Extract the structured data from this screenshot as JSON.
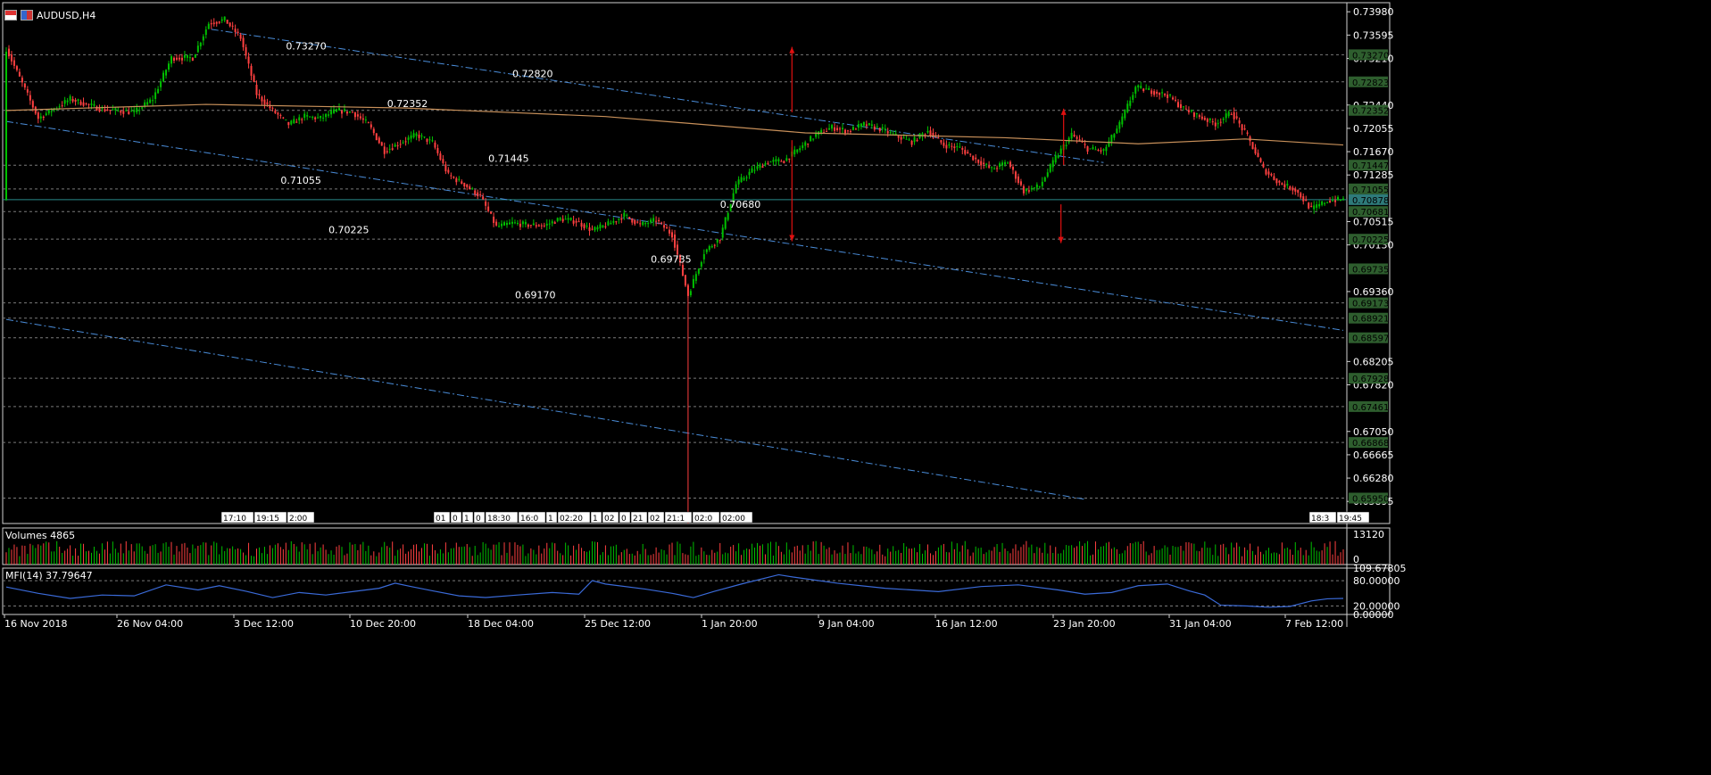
{
  "window": {
    "symbol_label": "AUDUSD,H4"
  },
  "price_axis": {
    "ticks": [
      "0.73980",
      "0.73595",
      "0.73210",
      "0.72440",
      "0.72055",
      "0.71670",
      "0.71285",
      "0.70515",
      "0.70130",
      "0.69360",
      "0.68205",
      "0.67820",
      "0.67050",
      "0.66665",
      "0.66280",
      "0.65895"
    ],
    "badges": [
      {
        "label": "0.73270",
        "value": 0.7327,
        "color": "#2e5e2e"
      },
      {
        "label": "0.72823",
        "value": 0.72823,
        "color": "#2e5e2e"
      },
      {
        "label": "0.72352",
        "value": 0.72352,
        "color": "#2e5e2e"
      },
      {
        "label": "0.71447",
        "value": 0.71447,
        "color": "#2e5e2e"
      },
      {
        "label": "0.71055",
        "value": 0.71055,
        "color": "#2e5e2e"
      },
      {
        "label": "0.70878",
        "value": 0.70878,
        "color": "#2e7a7a"
      },
      {
        "label": "0.70681",
        "value": 0.70681,
        "color": "#2e5e2e"
      },
      {
        "label": "0.70225",
        "value": 0.70225,
        "color": "#2e5e2e"
      },
      {
        "label": "0.69735",
        "value": 0.69735,
        "color": "#2e5e2e"
      },
      {
        "label": "0.69173",
        "value": 0.69173,
        "color": "#2e5e2e"
      },
      {
        "label": "0.68921",
        "value": 0.68921,
        "color": "#2e5e2e"
      },
      {
        "label": "0.68597",
        "value": 0.68597,
        "color": "#2e5e2e"
      },
      {
        "label": "0.67928",
        "value": 0.67928,
        "color": "#2e5e2e"
      },
      {
        "label": "0.67461",
        "value": 0.67461,
        "color": "#2e5e2e"
      },
      {
        "label": "0.66868",
        "value": 0.66868,
        "color": "#2e5e2e"
      },
      {
        "label": "0.65950",
        "value": 0.6595,
        "color": "#2e5e2e"
      }
    ]
  },
  "time_axis": {
    "labels": [
      "16 Nov 2018",
      "26 Nov 04:00",
      "3 Dec 12:00",
      "10 Dec 20:00",
      "18 Dec 04:00",
      "25 Dec 12:00",
      "1 Jan 20:00",
      "9 Jan 04:00",
      "16 Jan 12:00",
      "23 Jan 20:00",
      "31 Jan 04:00",
      "7 Feb 12:00"
    ]
  },
  "level_labels": [
    "0.73270",
    "0.72820",
    "0.72352",
    "0.71445",
    "0.71055",
    "0.70680",
    "0.70225",
    "0.69735",
    "0.69170"
  ],
  "event_markers": {
    "left": [
      "17:10",
      "19:15",
      "2:00"
    ],
    "middle": [
      "01",
      "0",
      "1",
      "0",
      "18:30",
      "16:0",
      "1",
      "02:20",
      "1",
      "02",
      "0",
      "21",
      "02",
      "21:1",
      "02:0",
      "02:00"
    ],
    "right": [
      "18:3",
      "19:45"
    ]
  },
  "volumes": {
    "title": "Volumes 4865",
    "ticks": [
      "13120",
      "0"
    ]
  },
  "mfi": {
    "title": "MFI(14) 37.79647",
    "ticks": [
      "109.67805",
      "80.00000",
      "20.00000",
      "0.00000"
    ]
  },
  "colors": {
    "bull": "#00c000",
    "bear": "#ff4040",
    "trendline": "#4a8cd8",
    "ma": "#c8905a",
    "mfi": "#3a6ad8",
    "arrow": "#e01010",
    "bid": "#2a8a8a"
  },
  "chart_data": {
    "type": "candlestick",
    "symbol": "AUDUSD",
    "timeframe": "H4",
    "ylim": [
      0.6553,
      0.7413
    ],
    "close_last": 0.70878,
    "close_path": [
      [
        0,
        0.7337
      ],
      [
        12,
        0.7222
      ],
      [
        24,
        0.7254
      ],
      [
        36,
        0.7237
      ],
      [
        48,
        0.7232
      ],
      [
        55,
        0.7254
      ],
      [
        62,
        0.7322
      ],
      [
        70,
        0.7322
      ],
      [
        76,
        0.7379
      ],
      [
        82,
        0.7385
      ],
      [
        88,
        0.7355
      ],
      [
        94,
        0.7262
      ],
      [
        100,
        0.7235
      ],
      [
        106,
        0.7212
      ],
      [
        112,
        0.7225
      ],
      [
        118,
        0.7222
      ],
      [
        124,
        0.7235
      ],
      [
        130,
        0.7232
      ],
      [
        136,
        0.7212
      ],
      [
        142,
        0.7168
      ],
      [
        148,
        0.7182
      ],
      [
        154,
        0.7195
      ],
      [
        160,
        0.7182
      ],
      [
        166,
        0.7128
      ],
      [
        172,
        0.7113
      ],
      [
        178,
        0.7093
      ],
      [
        184,
        0.7043
      ],
      [
        190,
        0.7049
      ],
      [
        196,
        0.7046
      ],
      [
        202,
        0.7045
      ],
      [
        208,
        0.7056
      ],
      [
        214,
        0.7052
      ],
      [
        220,
        0.7037
      ],
      [
        226,
        0.7047
      ],
      [
        232,
        0.7062
      ],
      [
        238,
        0.7046
      ],
      [
        244,
        0.7054
      ],
      [
        250,
        0.703
      ],
      [
        256,
        0.693
      ],
      [
        262,
        0.7001
      ],
      [
        268,
        0.7025
      ],
      [
        274,
        0.7113
      ],
      [
        280,
        0.7136
      ],
      [
        286,
        0.715
      ],
      [
        292,
        0.7152
      ],
      [
        298,
        0.7173
      ],
      [
        304,
        0.7195
      ],
      [
        310,
        0.7207
      ],
      [
        316,
        0.7201
      ],
      [
        322,
        0.7212
      ],
      [
        328,
        0.7205
      ],
      [
        334,
        0.7193
      ],
      [
        340,
        0.7183
      ],
      [
        346,
        0.7202
      ],
      [
        352,
        0.7178
      ],
      [
        358,
        0.7173
      ],
      [
        364,
        0.7154
      ],
      [
        370,
        0.7138
      ],
      [
        376,
        0.715
      ],
      [
        382,
        0.7102
      ],
      [
        388,
        0.711
      ],
      [
        394,
        0.7157
      ],
      [
        400,
        0.7195
      ],
      [
        406,
        0.7172
      ],
      [
        412,
        0.7168
      ],
      [
        418,
        0.7212
      ],
      [
        424,
        0.7273
      ],
      [
        430,
        0.7267
      ],
      [
        436,
        0.726
      ],
      [
        442,
        0.7238
      ],
      [
        448,
        0.7225
      ],
      [
        454,
        0.7213
      ],
      [
        460,
        0.7232
      ],
      [
        466,
        0.7192
      ],
      [
        472,
        0.7138
      ],
      [
        478,
        0.7115
      ],
      [
        484,
        0.7104
      ],
      [
        490,
        0.7072
      ],
      [
        496,
        0.7086
      ],
      [
        502,
        0.7088
      ]
    ],
    "moving_average": [
      [
        0,
        0.7235
      ],
      [
        75,
        0.7245
      ],
      [
        150,
        0.7239
      ],
      [
        225,
        0.7225
      ],
      [
        300,
        0.7198
      ],
      [
        375,
        0.719
      ],
      [
        425,
        0.718
      ],
      [
        465,
        0.7188
      ],
      [
        502,
        0.7178
      ]
    ],
    "trendlines": [
      {
        "from": [
          77,
          0.7369
        ],
        "to": [
          412,
          0.7149
        ],
        "style": "dash-dot"
      },
      {
        "from": [
          0,
          0.7217
        ],
        "to": [
          502,
          0.6872
        ],
        "style": "dash-dot"
      },
      {
        "from": [
          0,
          0.689
        ],
        "to": [
          405,
          0.6593
        ],
        "style": "dash-dot"
      }
    ],
    "level_lines": [
      0.7327,
      0.72823,
      0.72352,
      0.71447,
      0.71055,
      0.70878,
      0.70681,
      0.70225,
      0.69735,
      0.69173,
      0.68921,
      0.68597,
      0.67928,
      0.67461,
      0.66868,
      0.6595
    ],
    "volume_max": 13120,
    "mfi_range": [
      0.0,
      109.67805
    ],
    "mfi_levels": [
      80,
      20
    ],
    "mfi_last": 37.79647,
    "mfi_path": [
      [
        0,
        65
      ],
      [
        12,
        50
      ],
      [
        24,
        38
      ],
      [
        36,
        46
      ],
      [
        48,
        44
      ],
      [
        60,
        70
      ],
      [
        72,
        58
      ],
      [
        80,
        68
      ],
      [
        90,
        55
      ],
      [
        100,
        40
      ],
      [
        110,
        52
      ],
      [
        120,
        46
      ],
      [
        130,
        54
      ],
      [
        140,
        62
      ],
      [
        146,
        74
      ],
      [
        152,
        66
      ],
      [
        160,
        56
      ],
      [
        170,
        44
      ],
      [
        180,
        40
      ],
      [
        192,
        46
      ],
      [
        205,
        52
      ],
      [
        215,
        48
      ],
      [
        220,
        80
      ],
      [
        225,
        72
      ],
      [
        240,
        60
      ],
      [
        250,
        50
      ],
      [
        258,
        40
      ],
      [
        266,
        55
      ],
      [
        276,
        72
      ],
      [
        290,
        94
      ],
      [
        296,
        88
      ],
      [
        312,
        74
      ],
      [
        330,
        62
      ],
      [
        350,
        54
      ],
      [
        366,
        66
      ],
      [
        380,
        70
      ],
      [
        395,
        58
      ],
      [
        405,
        48
      ],
      [
        415,
        52
      ],
      [
        425,
        68
      ],
      [
        436,
        72
      ],
      [
        444,
        56
      ],
      [
        450,
        46
      ],
      [
        456,
        22
      ],
      [
        466,
        20
      ],
      [
        474,
        17
      ],
      [
        482,
        19
      ],
      [
        490,
        32
      ],
      [
        496,
        37
      ],
      [
        502,
        38
      ]
    ]
  }
}
